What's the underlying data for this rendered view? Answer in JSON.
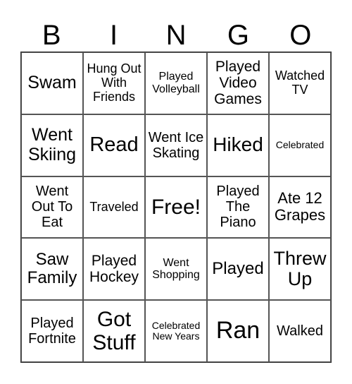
{
  "header": [
    "B",
    "I",
    "N",
    "G",
    "O"
  ],
  "cells": [
    "Swam",
    "Hung Out With Friends",
    "Played Volleyball",
    "Played Video Games",
    "Watched TV",
    "Went Skiing",
    "Read",
    "Went Ice Skating",
    "Hiked",
    "Celebrated",
    "Went Out To Eat",
    "Traveled",
    "Free!",
    "Played The Piano",
    "Ate 12 Grapes",
    "Saw Family",
    "Played Hockey",
    "Went Shopping",
    "Played",
    "Threw Up",
    "Played Fortnite",
    "Got Stuff",
    "Celebrated New Years",
    "Ran",
    "Walked"
  ]
}
